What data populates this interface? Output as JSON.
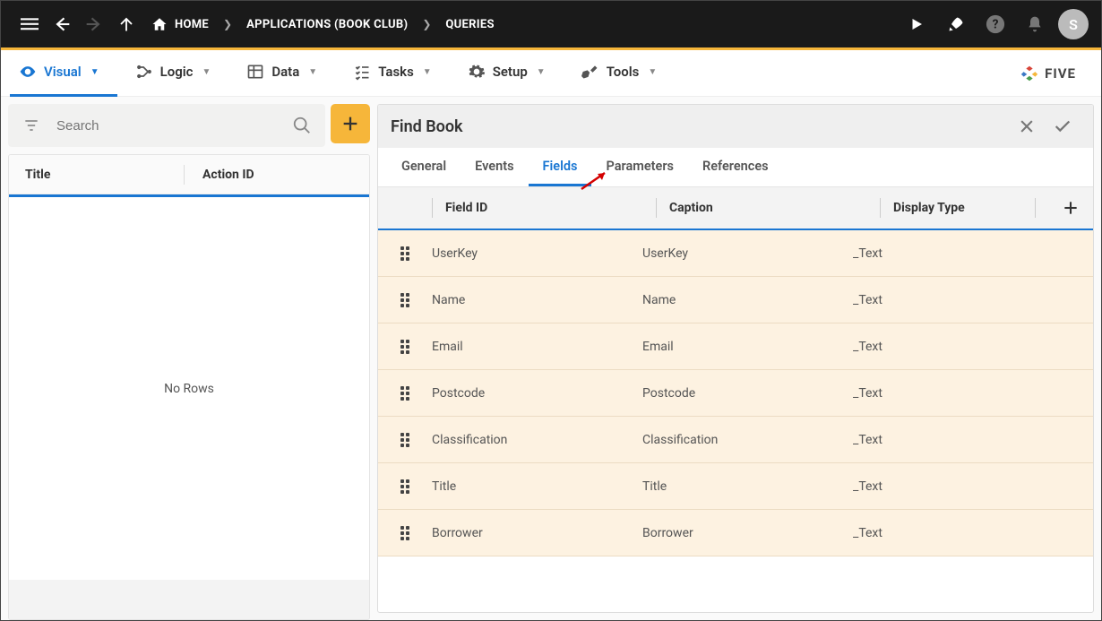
{
  "topbar": {
    "breadcrumbs": [
      {
        "label": "HOME",
        "icon": "home"
      },
      {
        "label": "APPLICATIONS (BOOK CLUB)"
      },
      {
        "label": "QUERIES"
      }
    ],
    "avatar_initial": "S"
  },
  "menubar": {
    "items": [
      {
        "label": "Visual",
        "icon": "eye",
        "active": true
      },
      {
        "label": "Logic",
        "icon": "branches"
      },
      {
        "label": "Data",
        "icon": "table"
      },
      {
        "label": "Tasks",
        "icon": "checklist"
      },
      {
        "label": "Setup",
        "icon": "gear"
      },
      {
        "label": "Tools",
        "icon": "wrench"
      }
    ],
    "brand": "FIVE"
  },
  "left": {
    "search_placeholder": "Search",
    "columns": {
      "title": "Title",
      "action_id": "Action ID"
    },
    "empty_text": "No Rows"
  },
  "right": {
    "title": "Find Book",
    "tabs": [
      {
        "label": "General"
      },
      {
        "label": "Events"
      },
      {
        "label": "Fields",
        "active": true
      },
      {
        "label": "Parameters"
      },
      {
        "label": "References"
      }
    ],
    "grid": {
      "columns": {
        "field_id": "Field ID",
        "caption": "Caption",
        "display_type": "Display Type"
      },
      "rows": [
        {
          "field_id": "UserKey",
          "caption": "UserKey",
          "display_type": "_Text"
        },
        {
          "field_id": "Name",
          "caption": "Name",
          "display_type": "_Text"
        },
        {
          "field_id": "Email",
          "caption": "Email",
          "display_type": "_Text"
        },
        {
          "field_id": "Postcode",
          "caption": "Postcode",
          "display_type": "_Text"
        },
        {
          "field_id": "Classification",
          "caption": "Classification",
          "display_type": "_Text"
        },
        {
          "field_id": "Title",
          "caption": "Title",
          "display_type": "_Text"
        },
        {
          "field_id": "Borrower",
          "caption": "Borrower",
          "display_type": "_Text"
        }
      ]
    }
  }
}
